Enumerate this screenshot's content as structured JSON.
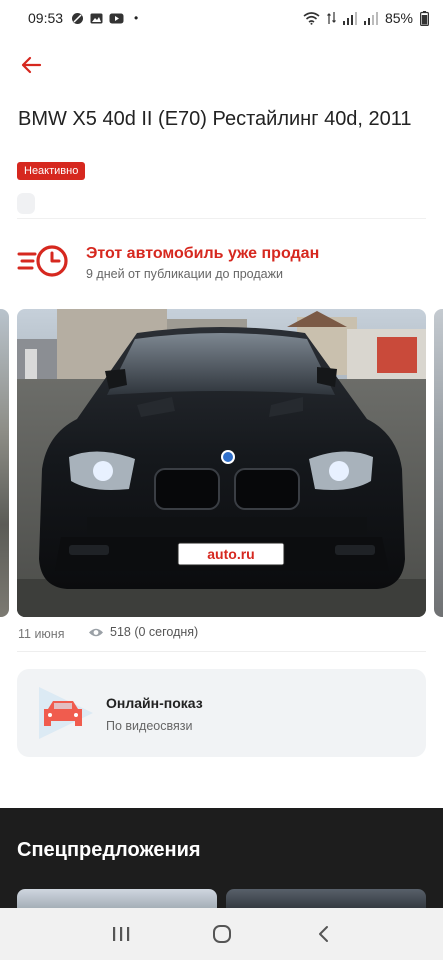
{
  "status_bar": {
    "time": "09:53",
    "battery": "85%",
    "dot": "•"
  },
  "header": {
    "back_icon": "arrow-left-icon"
  },
  "listing": {
    "title": "BMW X5 40d II (E70) Рестайлинг 40d, 2011",
    "badge": "Неактивно"
  },
  "sold": {
    "icon": "sold-clock-icon",
    "title": "Этот автомобиль уже продан",
    "subtitle": "9 дней от публикации до продажи"
  },
  "photo": {
    "plate_text": "auto.ru"
  },
  "meta": {
    "date": "11 июня",
    "views": "518 (0 сегодня)",
    "views_icon": "eye-icon"
  },
  "online_show": {
    "title": "Онлайн-показ",
    "subtitle": "По видеосвязи",
    "icon": "car-play-icon"
  },
  "specials": {
    "heading": "Спецпредложения"
  },
  "nav": {
    "recent_icon": "recent-apps-icon",
    "home_icon": "home-icon",
    "back_icon": "back-chevron-icon"
  },
  "colors": {
    "accent": "#d6281f",
    "dark_section": "#1d1d1d",
    "card_bg": "#f1f3f5"
  }
}
